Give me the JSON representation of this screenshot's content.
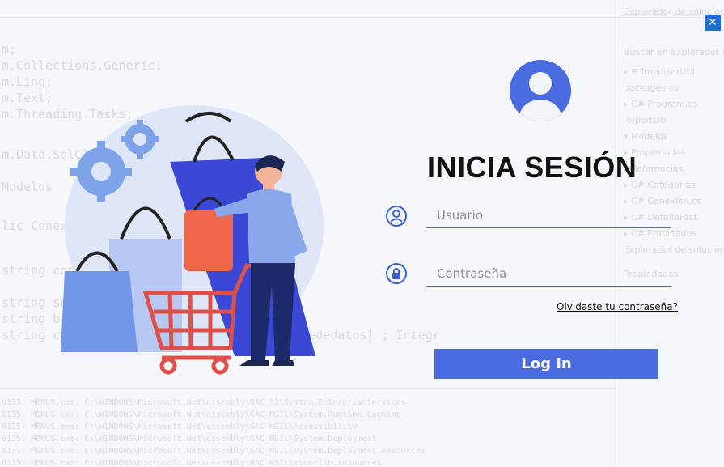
{
  "window": {
    "close_label": "✕"
  },
  "form": {
    "title": "INICIA SESIÓN",
    "username_placeholder": "Usuario",
    "password_placeholder": "Contraseña",
    "forgot_link": "Olvidaste tu contraseña?",
    "login_button": "Log In"
  },
  "colors": {
    "accent": "#4b6be0",
    "close": "#1f6fd1",
    "avatar": "#4b6be0",
    "icon": "#3f5fd0"
  },
  "icons": {
    "avatar": "user-avatar-icon",
    "username": "user-circle-icon",
    "password": "lock-icon",
    "close": "close-icon"
  }
}
